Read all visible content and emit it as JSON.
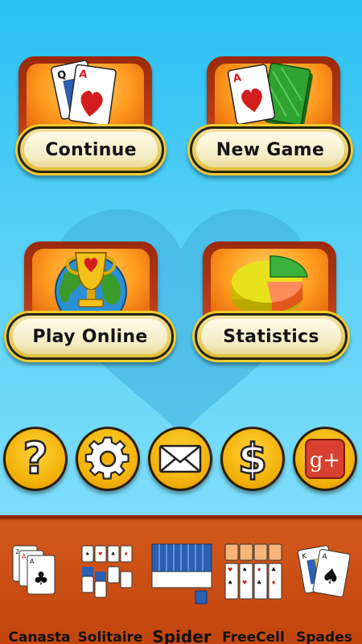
{
  "menu": {
    "continue_label": "Continue",
    "new_game_label": "New Game",
    "play_online_label": "Play Online",
    "statistics_label": "Statistics"
  },
  "toolbar": {
    "icons": [
      "help-icon",
      "settings-gear-icon",
      "mail-icon",
      "dollar-icon",
      "google-plus-icon"
    ],
    "help_glyph": "?",
    "dollar_glyph": "$",
    "gplus_glyph": "g+"
  },
  "games": {
    "items": [
      {
        "label": "Canasta"
      },
      {
        "label": "Solitaire"
      },
      {
        "label": "Spider"
      },
      {
        "label": "FreeCell"
      },
      {
        "label": "Spades"
      }
    ]
  },
  "colors": {
    "sky": "#29c0f2",
    "tile_orange": "#ff9a1e",
    "button_gold": "#f2b109",
    "bottom_bar": "#c2450f"
  }
}
